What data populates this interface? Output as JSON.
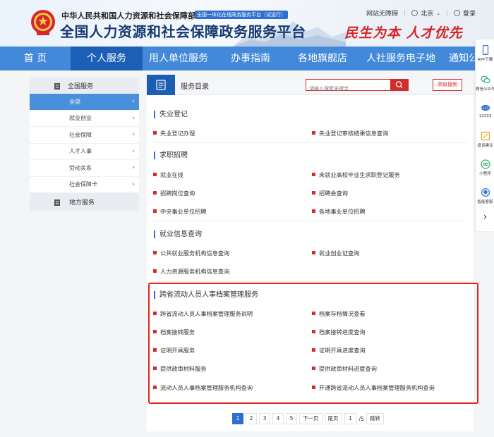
{
  "header": {
    "gov_name": "中华人民共和国人力资源和社会保障部",
    "tag": "全国一体化在线政务服务平台（试运行）",
    "site_title": "全国人力资源和社会保障政务服务平台",
    "slogan": "民生为本 人才优先",
    "tools": {
      "accessibility": "网站无障碍",
      "city": "北京",
      "login": "登录"
    }
  },
  "nav": {
    "items": [
      "首 页",
      "个人服务",
      "用人单位服务",
      "办事指南",
      "各地旗舰店",
      "人社服务电子地",
      "通知公"
    ]
  },
  "float_bar": {
    "items": [
      "APP下载",
      "微信公众号",
      "12333",
      "投诉建议",
      "小程序",
      "智能客服"
    ]
  },
  "sidebar": {
    "head": "全国服务",
    "items": [
      "全部",
      "就业创业",
      "社会保障",
      "人才人事",
      "劳动关系",
      "社会保障卡"
    ],
    "head2": "地方服务"
  },
  "main": {
    "title": "服务目录",
    "search_placeholder": "请输入搜索关键字",
    "advanced": "高级搜索",
    "sections": [
      {
        "title": "失业登记",
        "items": [
          "失业登记办理",
          "失业登记审核结果信息查询"
        ]
      },
      {
        "title": "求职招聘",
        "items": [
          "就业在线",
          "未就业高校毕业生求职登记服务",
          "招聘岗位查询",
          "招聘会查询",
          "中央事业单位招聘",
          "各地事业单位招聘"
        ]
      },
      {
        "title": "就业信息查询",
        "items": [
          "公共就业服务机构信息查询",
          "就业创业证查询",
          "人力资源服务机构信息查询"
        ]
      },
      {
        "title": "跨省流动人员人事档案管理服务",
        "items": [
          "跨省流动人员人事档案管理服务说明",
          "档案存档情况查看",
          "档案接转服务",
          "档案接转进度查询",
          "证明开具服务",
          "证明开具进度查询",
          "提供政审材料服务",
          "提供政审材料进度查询",
          "流动人员人事档案管理服务机构查询",
          "开通跨省流动人员人事档案管理服务机构查询"
        ]
      }
    ]
  },
  "pager": {
    "pages": [
      "1",
      "2",
      "3",
      "4",
      "5"
    ],
    "next": "下一页",
    "last": "尾页",
    "current": "1",
    "total": "/5",
    "jump": "跳转"
  },
  "colors": {
    "nav_blue": "#4289d9",
    "nav_active": "#1c5fb6",
    "accent_red": "#d42b2b",
    "title_blue": "#163a72"
  }
}
